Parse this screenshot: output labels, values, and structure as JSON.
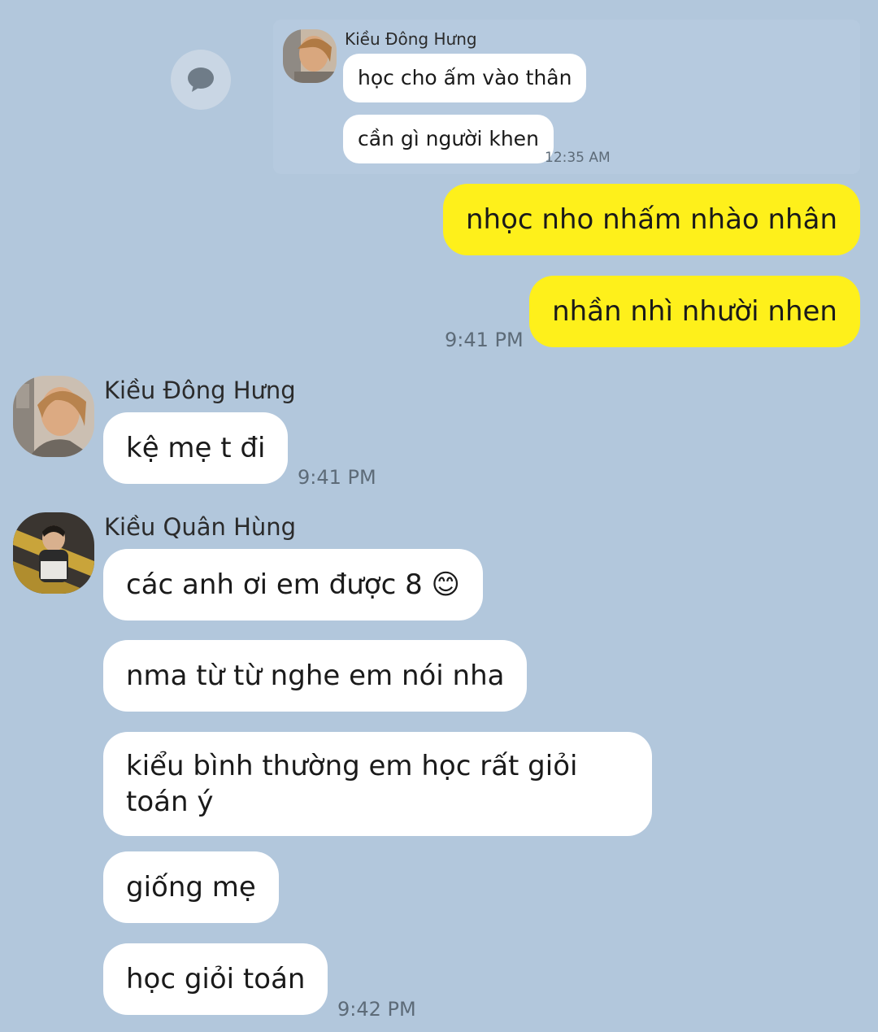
{
  "quoted": {
    "sender": "Kiều Đông Hưng",
    "messages": [
      "học cho ấm vào thân",
      "cần gì người khen"
    ],
    "time": "12:35 AM",
    "icon": "chat-bubble-icon"
  },
  "outgoing": {
    "messages": [
      "nhọc nho nhấm nhào nhân",
      "nhần nhì nhười nhen"
    ],
    "time": "9:41 PM"
  },
  "sender1": {
    "name": "Kiều Đông Hưng",
    "messages": [
      "kệ mẹ t đi"
    ],
    "time": "9:41 PM"
  },
  "sender2": {
    "name": "Kiều Quân Hùng",
    "messages": [
      "các anh ơi em được 8 😊",
      "nma từ từ nghe em nói nha",
      "kiểu bình thường em học rất giỏi",
      "toán ý",
      "giống mẹ",
      "học giỏi toán"
    ],
    "time": "9:42 PM"
  },
  "colors": {
    "background": "#b2c7dc",
    "outgoing_bubble": "#fef01b",
    "incoming_bubble": "#ffffff"
  }
}
